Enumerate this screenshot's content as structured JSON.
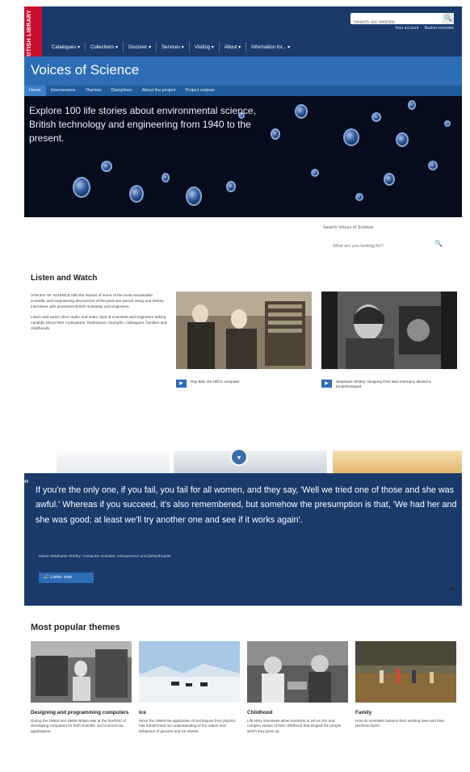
{
  "header": {
    "logo_text": "BRITISH LIBRARY",
    "search_placeholder": "Search our website",
    "search_button": "🔍",
    "account_links": [
      "Your account",
      "Basket overview"
    ],
    "nav": [
      "Catalogues ▾",
      "Collections ▾",
      "Discover ▾",
      "Services ▾",
      "Visiting ▾",
      "About ▾",
      "Information for... ▾"
    ]
  },
  "site": {
    "title": "Voices of Science",
    "nav": [
      "Home",
      "Interviewees",
      "Themes",
      "Disciplines",
      "About the project",
      "Project outputs"
    ]
  },
  "hero": {
    "text": "Explore 100 life stories about environmental science, British technology and engineering from 1940 to the present."
  },
  "search": {
    "label": "Search Voices of Science",
    "placeholder": "What are you looking for?"
  },
  "listen_watch": {
    "title": "Listen and Watch",
    "paragraphs": [
      "VOICES OF SCIENCE tells the stories of some of the most remarkable scientific and engineering discoveries of the post-war period using oral history interviews with prominent British scientists and engineers.",
      "Listen and watch short audio and video clips of scientists and engineers talking candidly about their motivations, frustrations, triumphs, colleagues, families and childhoods."
    ],
    "cards": [
      {
        "caption": "Ray Bird, the HEC1 computer"
      },
      {
        "caption": "Stephanie Shirley: escaping from Nazi Germany aboard a Kindertransport"
      }
    ]
  },
  "quote": {
    "text": "If you're the only one, if you fail, you fail for all women, and they say, 'Well we tried one of those and she was awful.' Whereas if you succeed, it's also remembered, but somehow the presumption is that, 'We had her and she was good; at least we'll try another one and see if it works again'.",
    "attribution": "Dame Stephanie Shirley: Computer scientist, entrepreneur and philanthropist",
    "listen_label": "Listen now",
    "open_mark": "“",
    "close_mark": "”"
  },
  "themes": {
    "title": "Most popular themes",
    "items": [
      {
        "title": "Designing and programming computers",
        "text": "During the 1950s and 1960s Britain was at the forefront of developing computers for both scientific and commercial applications."
      },
      {
        "title": "Ice",
        "text": "Since the 1950s the application of techniques from physics has transformed our understanding of the nature and behaviour of glaciers and ice sheets."
      },
      {
        "title": "Childhood",
        "text": "Life story interviews allow scientists to tell us rich and complex stories of their childhood that shaped the people which they grew up."
      },
      {
        "title": "Family",
        "text": "How do scientists balance their working lives and their personal lives?"
      }
    ]
  },
  "colors": {
    "bl_header": "#1a3a6c",
    "bl_red": "#c8102e",
    "vos_blue": "#2d6db5",
    "quote_bg": "#1a3a6a"
  }
}
